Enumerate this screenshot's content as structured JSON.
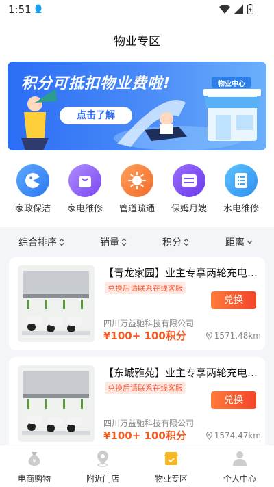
{
  "status_bar": {
    "time": "1:51"
  },
  "header": {
    "title": "物业专区"
  },
  "banner": {
    "headline": "积分可抵扣物业费啦!",
    "button_label": "点击了解",
    "sign_text": "物业中心"
  },
  "categories": [
    {
      "label": "家政保洁",
      "icon": "cleaning-icon",
      "color": "#3a8ef6"
    },
    {
      "label": "家电维修",
      "icon": "shopping-bag-icon",
      "color": "#8a5cf6"
    },
    {
      "label": "管道疏通",
      "icon": "sun-icon",
      "color": "#f97a3a"
    },
    {
      "label": "保姆月嫂",
      "icon": "card-icon",
      "color": "#7a4cf2"
    },
    {
      "label": "水电维修",
      "icon": "document-icon",
      "color": "#3aa8f6"
    }
  ],
  "sort_bar": [
    {
      "label": "综合排序",
      "icon": "sort-arrows-icon"
    },
    {
      "label": "销量",
      "icon": "sort-arrows-icon"
    },
    {
      "label": "积分",
      "icon": "sort-arrows-icon"
    },
    {
      "label": "距离",
      "icon": "chevron-down-icon"
    }
  ],
  "products": [
    {
      "title": "【青龙家园】业主专享两轮充电桩服务",
      "tag": "兑换后请联系在线客服",
      "button": "兑换",
      "company": "四川万益驰科技有限公司",
      "price": "¥100+ 100积分",
      "distance": "1571.48km"
    },
    {
      "title": "【东城雅苑】业主专享两轮充电桩服务",
      "tag": "兑换后请联系在线客服",
      "button": "兑换",
      "company": "四川万益驰科技有限公司",
      "price": "¥100+ 100积分",
      "distance": "1574.47km"
    }
  ],
  "bottom_nav": [
    {
      "label": "电商购物",
      "icon": "money-bag-icon",
      "active": false
    },
    {
      "label": "附近门店",
      "icon": "location-icon",
      "active": false
    },
    {
      "label": "物业专区",
      "icon": "property-icon",
      "active": true
    },
    {
      "label": "个人中心",
      "icon": "user-icon",
      "active": false
    }
  ],
  "colors": {
    "accent": "#f25c22",
    "primary": "#2b6df5",
    "active_nav": "#f5b823"
  }
}
